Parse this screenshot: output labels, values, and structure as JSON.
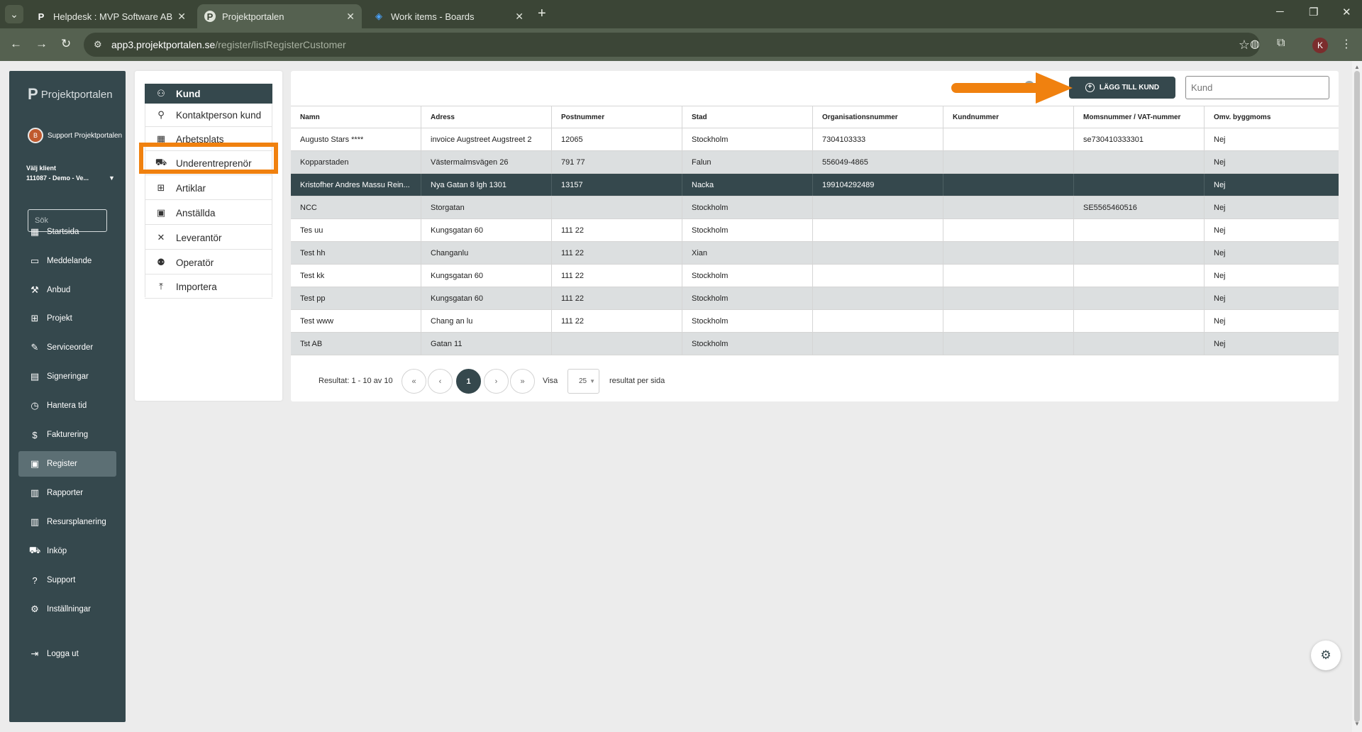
{
  "browser": {
    "tabs": [
      {
        "title": "Helpdesk : MVP Software AB",
        "icon": "p-logo-icon",
        "active": false
      },
      {
        "title": "Projektportalen",
        "icon": "p-circle-icon",
        "active": true
      },
      {
        "title": "Work items - Boards",
        "icon": "azure-devops-icon",
        "active": false
      }
    ],
    "url_host": "app3.projektportalen.se",
    "url_path": "/register/listRegisterCustomer",
    "profile_initial": "K"
  },
  "sidebar": {
    "logo_text": "Projektportalen",
    "support_label": "Support Projektportalen",
    "client_label": "Välj klient",
    "client_value": "111087 - Demo - Ve...",
    "search_placeholder": "Sök",
    "items": [
      {
        "label": "Startsida",
        "icon": "dashboard-icon"
      },
      {
        "label": "Meddelande",
        "icon": "message-icon"
      },
      {
        "label": "Anbud",
        "icon": "gavel-icon"
      },
      {
        "label": "Projekt",
        "icon": "grid-icon"
      },
      {
        "label": "Serviceorder",
        "icon": "wrench-icon"
      },
      {
        "label": "Signeringar",
        "icon": "document-icon"
      },
      {
        "label": "Hantera tid",
        "icon": "clock-icon"
      },
      {
        "label": "Fakturering",
        "icon": "dollar-icon"
      },
      {
        "label": "Register",
        "icon": "register-icon",
        "active": true
      },
      {
        "label": "Rapporter",
        "icon": "calendar-icon"
      },
      {
        "label": "Resursplanering",
        "icon": "calendar-icon"
      },
      {
        "label": "Inköp",
        "icon": "cart-icon"
      },
      {
        "label": "Support",
        "icon": "help-icon"
      },
      {
        "label": "Inställningar",
        "icon": "gear-icon"
      }
    ],
    "logout_label": "Logga ut"
  },
  "submenu": {
    "items": [
      {
        "label": "Kund",
        "icon": "users-icon",
        "active": true
      },
      {
        "label": "Kontaktperson kund",
        "icon": "contact-icon"
      },
      {
        "label": "Arbetsplats",
        "icon": "building-icon"
      },
      {
        "label": "Underentreprenör",
        "icon": "truck-icon"
      },
      {
        "label": "Artiklar",
        "icon": "boxes-icon"
      },
      {
        "label": "Anställda",
        "icon": "badge-icon"
      },
      {
        "label": "Leverantör",
        "icon": "tools-icon"
      },
      {
        "label": "Operatör",
        "icon": "operator-icon"
      },
      {
        "label": "Importera",
        "icon": "upload-icon"
      }
    ]
  },
  "main": {
    "add_button_label": "LÄGG TILL KUND",
    "search_placeholder": "Kund",
    "columns": [
      "Namn",
      "Adress",
      "Postnummer",
      "Stad",
      "Organisationsnummer",
      "Kundnummer",
      "Momsnummer / VAT-nummer",
      "Omv. byggmoms"
    ],
    "rows": [
      [
        "Augusto Stars ****",
        "invoice Augstreet Augstreet 2",
        "12065",
        "Stockholm",
        "7304103333",
        "",
        "se730410333301",
        "Nej"
      ],
      [
        "Kopparstaden",
        "Västermalmsvägen 26",
        "791 77",
        "Falun",
        "556049-4865",
        "",
        "",
        "Nej"
      ],
      [
        "Kristofher Andres Massu Rein...",
        "Nya Gatan 8 lgh 1301",
        "13157",
        "Nacka",
        "199104292489",
        "",
        "",
        "Nej"
      ],
      [
        "NCC",
        "Storgatan",
        "",
        "Stockholm",
        "",
        "",
        "SE5565460516",
        "Nej"
      ],
      [
        "Tes uu",
        "Kungsgatan 60",
        "111 22",
        "Stockholm",
        "",
        "",
        "",
        "Nej"
      ],
      [
        "Test hh",
        "Changanlu",
        "111 22",
        "Xian",
        "",
        "",
        "",
        "Nej"
      ],
      [
        "Test kk",
        "Kungsgatan 60",
        "111 22",
        "Stockholm",
        "",
        "",
        "",
        "Nej"
      ],
      [
        "Test pp",
        "Kungsgatan 60",
        "111 22",
        "Stockholm",
        "",
        "",
        "",
        "Nej"
      ],
      [
        "Test www",
        "Chang an lu",
        "111 22",
        "Stockholm",
        "",
        "",
        "",
        "Nej"
      ],
      [
        "Tst AB",
        "Gatan 11",
        "",
        "Stockholm",
        "",
        "",
        "",
        "Nej"
      ]
    ],
    "selected_row": 2,
    "pagination": {
      "result_text": "Resultat: 1 - 10 av 10",
      "first": "«",
      "prev": "‹",
      "current": "1",
      "next": "›",
      "last": "»",
      "show_label": "Visa",
      "per_page": "25",
      "per_page_label": "resultat per sida"
    }
  },
  "colors": {
    "brand_dark": "#35484d",
    "annotation_orange": "#f0810f",
    "browser_frame": "#3b4536"
  }
}
